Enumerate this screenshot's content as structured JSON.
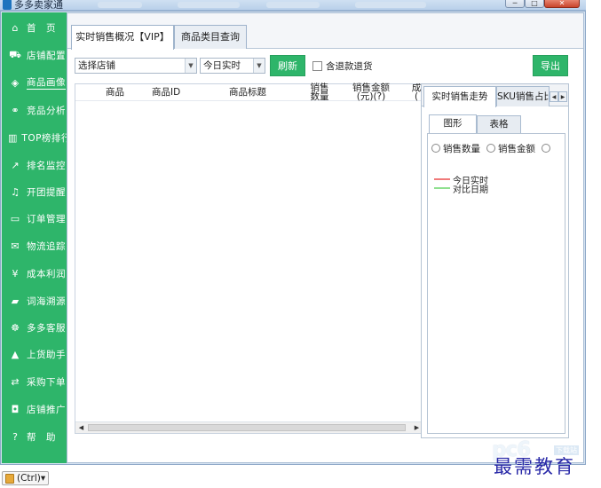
{
  "window": {
    "title": "多多卖家通",
    "controls": {
      "minimize": "─",
      "maximize": "□",
      "close": "✕"
    }
  },
  "sidebar": {
    "active_index": 2,
    "items": [
      {
        "label": "首　页",
        "icon": "home-icon",
        "glyph": "⌂"
      },
      {
        "label": "店铺配置",
        "icon": "cart-icon",
        "glyph": "⛟"
      },
      {
        "label": "商品画像",
        "icon": "cube-icon",
        "glyph": "◈"
      },
      {
        "label": "竞品分析",
        "icon": "competitor-icon",
        "glyph": "⚭"
      },
      {
        "label": "TOP榜排行",
        "icon": "bar-chart-icon",
        "glyph": "▥"
      },
      {
        "label": "排名监控",
        "icon": "line-chart-icon",
        "glyph": "↗"
      },
      {
        "label": "开团提醒",
        "icon": "bell-icon",
        "glyph": "♫"
      },
      {
        "label": "订单管理",
        "icon": "folder-icon",
        "glyph": "▭"
      },
      {
        "label": "物流追踪",
        "icon": "mail-icon",
        "glyph": "✉"
      },
      {
        "label": "成本利润",
        "icon": "yen-icon",
        "glyph": "¥"
      },
      {
        "label": "词海溯源",
        "icon": "book-icon",
        "glyph": "▰"
      },
      {
        "label": "多多客服",
        "icon": "service-icon",
        "glyph": "☸"
      },
      {
        "label": "上货助手",
        "icon": "truck-icon",
        "glyph": "▲"
      },
      {
        "label": "采购下单",
        "icon": "exchange-icon",
        "glyph": "⇄"
      },
      {
        "label": "店铺推广",
        "icon": "car-icon",
        "glyph": "◘"
      },
      {
        "label": "帮　助",
        "icon": "help-icon",
        "glyph": "?"
      }
    ]
  },
  "main_tabs": [
    {
      "label": "实时销售概况【VIP】",
      "active": true
    },
    {
      "label": "商品类目查询",
      "active": false
    }
  ],
  "toolbar": {
    "store_select": "选择店铺",
    "date_select": "今日实时",
    "refresh_label": "刷新",
    "include_refund_label": "含退款退货",
    "include_refund_checked": false,
    "export_label": "导出"
  },
  "grid": {
    "columns": [
      "商品",
      "商品ID",
      "商品标题",
      "销售\n数量",
      "销售金额\n(元)(?)",
      "成\n("
    ],
    "rows": []
  },
  "right_panel": {
    "tabs": [
      {
        "label": "实时销售走势",
        "active": true
      },
      {
        "label": "SKU销售占比",
        "active": false
      }
    ],
    "sub_tabs": [
      {
        "label": "图形",
        "active": true
      },
      {
        "label": "表格",
        "active": false
      }
    ],
    "radios": [
      {
        "label": "销售数量"
      },
      {
        "label": "销售金额"
      }
    ],
    "legend": [
      {
        "label": "今日实时",
        "color": "#f07a7a"
      },
      {
        "label": "对比日期",
        "color": "#8fe08f"
      }
    ]
  },
  "status": {
    "ctrl_label": "(Ctrl)▾"
  },
  "watermark": {
    "brand": "pc6",
    "brand_sub": "下载站",
    "text": "最需教育"
  },
  "colors": {
    "accent": "#2eb56a"
  }
}
